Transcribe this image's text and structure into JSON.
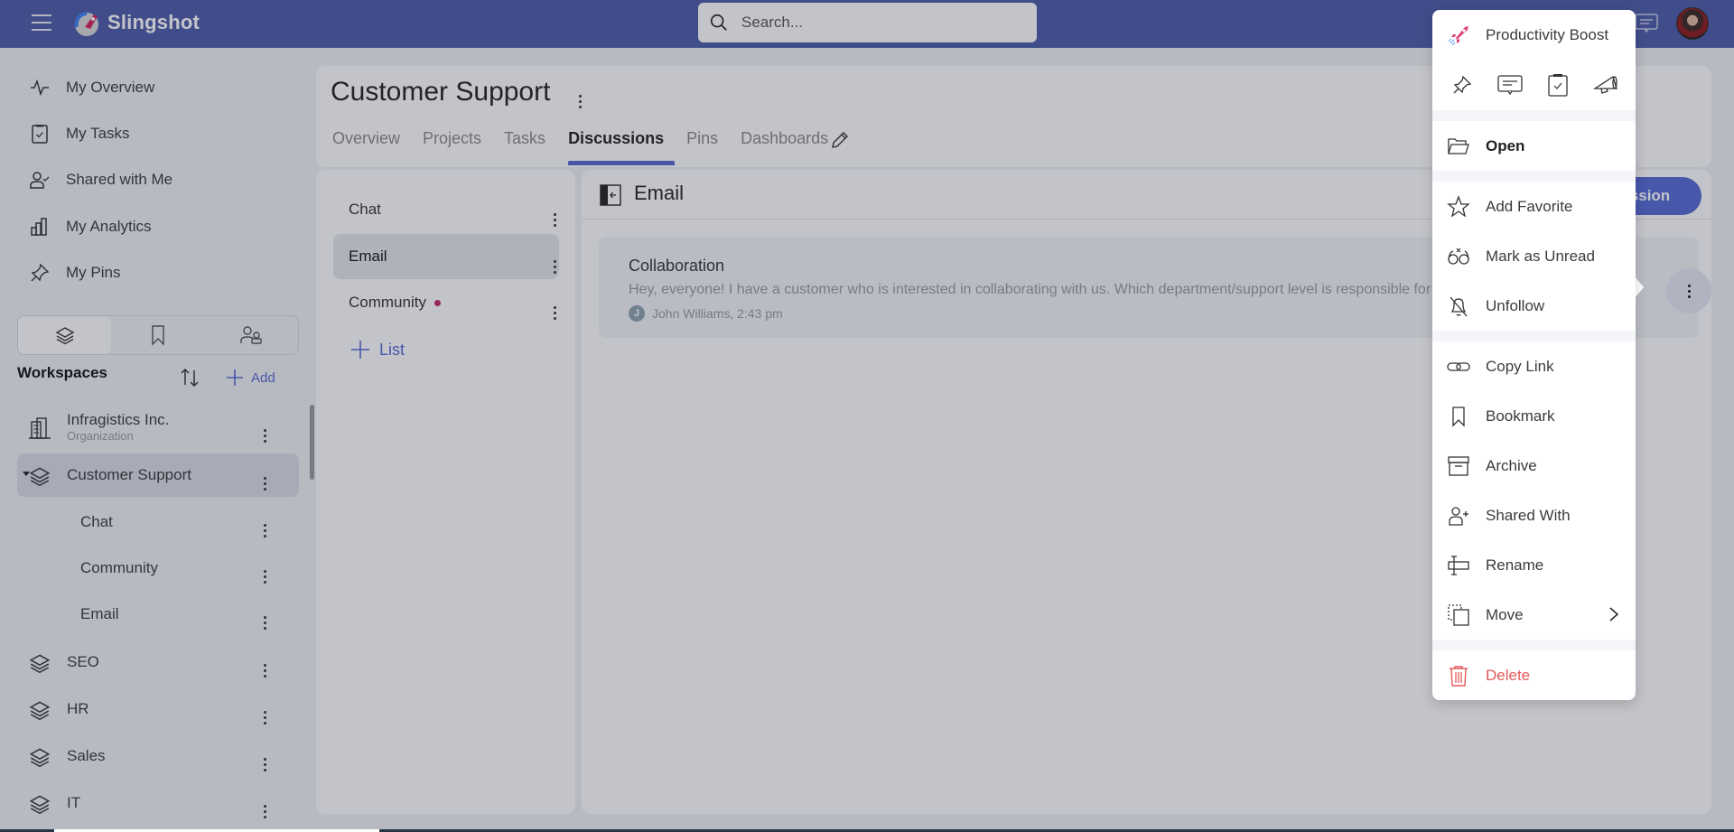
{
  "topbar": {
    "brand": "Slingshot",
    "search_placeholder": "Search..."
  },
  "sidebar": {
    "nav": [
      {
        "label": "My Overview",
        "icon": "activity-icon"
      },
      {
        "label": "My Tasks",
        "icon": "clipboard-check-icon"
      },
      {
        "label": "Shared with Me",
        "icon": "user-check-icon"
      },
      {
        "label": "My Analytics",
        "icon": "bar-chart-icon"
      },
      {
        "label": "My Pins",
        "icon": "pin-icon"
      }
    ],
    "segments": [
      "workspaces",
      "bookmarks",
      "people"
    ],
    "workspaces_title": "Workspaces",
    "add_label": "Add",
    "workspaces": [
      {
        "label": "Infragistics Inc.",
        "sublabel": "Organization"
      },
      {
        "label": "Customer Support",
        "children": [
          "Chat",
          "Community",
          "Email"
        ]
      },
      {
        "label": "SEO"
      },
      {
        "label": "HR"
      },
      {
        "label": "Sales"
      },
      {
        "label": "IT"
      }
    ]
  },
  "workspace": {
    "title": "Customer Support",
    "tabs": [
      "Overview",
      "Projects",
      "Tasks",
      "Discussions",
      "Pins",
      "Dashboards"
    ],
    "active_tab": "Discussions"
  },
  "lists": {
    "items": [
      {
        "label": "Chat",
        "unread": false
      },
      {
        "label": "Email",
        "unread": false
      },
      {
        "label": "Community",
        "unread": true
      }
    ],
    "selected": "Email",
    "add_label": "List"
  },
  "discussion": {
    "title": "Email",
    "new_button": "New Discussion",
    "cards": [
      {
        "title": "Collaboration",
        "preview": "Hey, everyone! I have a customer who is interested in collaborating with us. Which department/support level is responsible for this?",
        "author_initial": "J",
        "meta": "John Williams, 2:43 pm"
      }
    ]
  },
  "menu": {
    "header": "Productivity Boost",
    "quick_actions": [
      "pin-icon",
      "discussion-icon",
      "task-icon",
      "announcement-icon"
    ],
    "open": "Open",
    "group1": [
      "Add Favorite",
      "Mark as Unread",
      "Unfollow"
    ],
    "group2": [
      "Copy Link",
      "Bookmark",
      "Archive",
      "Shared With",
      "Rename",
      "Move"
    ],
    "delete": "Delete"
  },
  "colors": {
    "topbar": "#4a5aa8",
    "accent": "#5468d4",
    "danger": "#e45a5a",
    "unread_dot": "#c8246c"
  }
}
